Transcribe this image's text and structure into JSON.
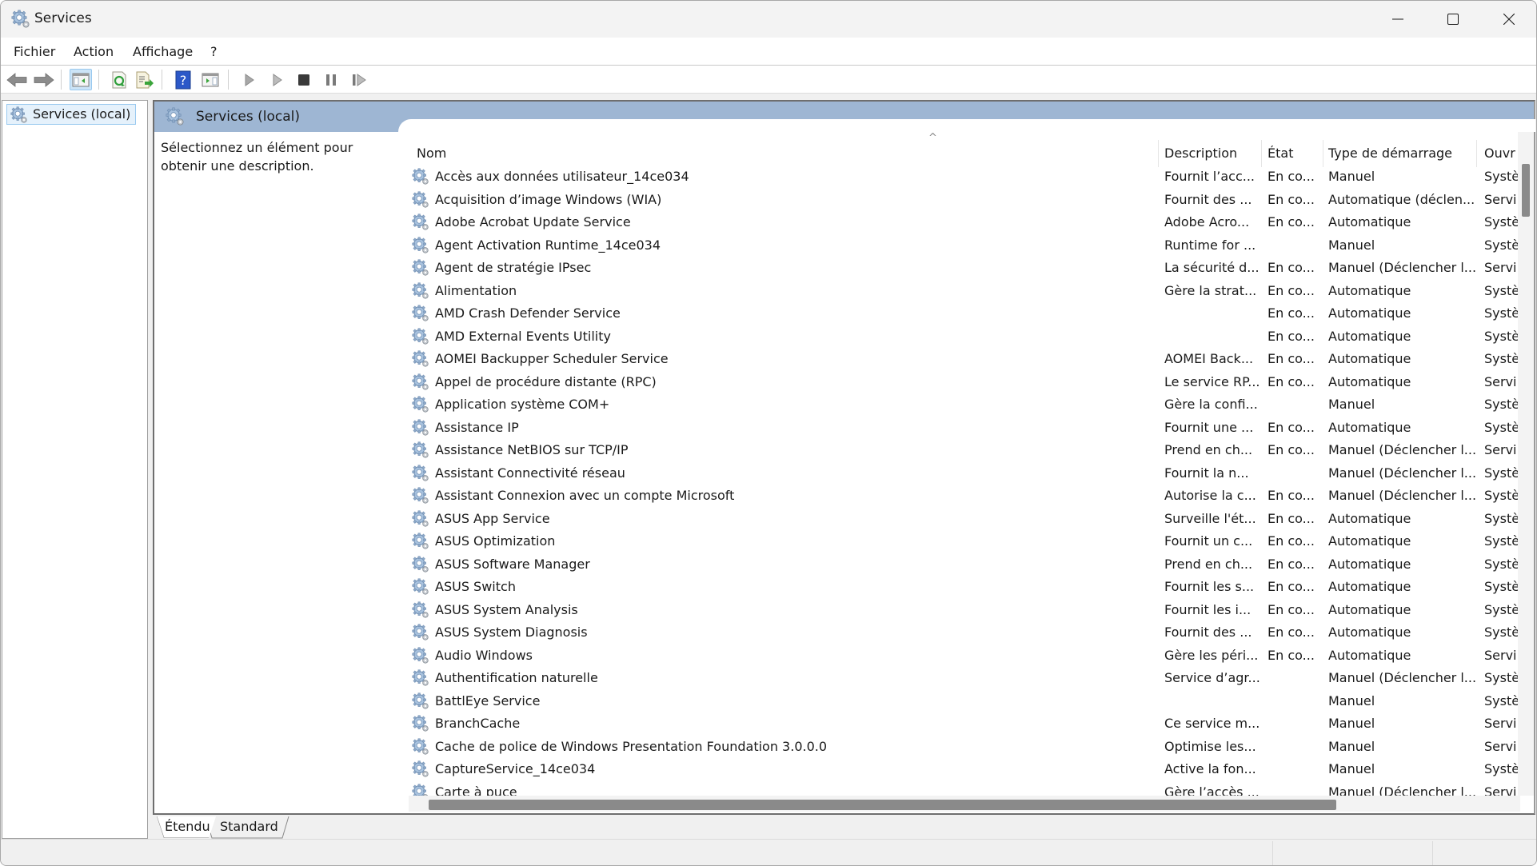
{
  "window": {
    "title": "Services",
    "app_icon": "services-gear-icon",
    "controls": {
      "minimize": "minimize-icon",
      "maximize": "maximize-icon",
      "close": "close-icon"
    }
  },
  "menu": {
    "items": [
      "Fichier",
      "Action",
      "Affichage",
      "?"
    ]
  },
  "toolbar": {
    "buttons": [
      {
        "name": "back",
        "icon": "arrow-left-icon"
      },
      {
        "name": "forward",
        "icon": "arrow-right-icon"
      },
      {
        "name": "show-hide-console-tree",
        "icon": "console-tree-icon",
        "active": true
      },
      {
        "name": "refresh",
        "icon": "refresh-icon"
      },
      {
        "name": "export-list",
        "icon": "export-list-icon"
      },
      {
        "name": "help",
        "icon": "help-icon"
      },
      {
        "name": "show-hide-action-pane",
        "icon": "action-pane-icon"
      },
      {
        "name": "start-service",
        "icon": "play-icon"
      },
      {
        "name": "start-service-alt",
        "icon": "play-outline-icon"
      },
      {
        "name": "stop-service",
        "icon": "stop-icon"
      },
      {
        "name": "pause-service",
        "icon": "pause-icon"
      },
      {
        "name": "restart-service",
        "icon": "restart-icon"
      }
    ]
  },
  "tree": {
    "selected_item": "Services (local)"
  },
  "main": {
    "header_title": "Services (local)",
    "description_prompt": "Sélectionnez un élément pour obtenir une description.",
    "columns": [
      "Nom",
      "Description",
      "État",
      "Type de démarrage",
      "Ouvr"
    ],
    "sorted_column": "Nom",
    "rows": [
      {
        "name": "Accès aux données utilisateur_14ce034",
        "description": "Fournit l’acc...",
        "state": "En co...",
        "startup": "Manuel",
        "logon": "Systè"
      },
      {
        "name": "Acquisition d’image Windows (WIA)",
        "description": "Fournit des ...",
        "state": "En co...",
        "startup": "Automatique (déclen...",
        "logon": "Servi"
      },
      {
        "name": "Adobe Acrobat Update Service",
        "description": "Adobe Acro...",
        "state": "En co...",
        "startup": "Automatique",
        "logon": "Systè"
      },
      {
        "name": "Agent Activation Runtime_14ce034",
        "description": "Runtime for ...",
        "state": "",
        "startup": "Manuel",
        "logon": "Systè"
      },
      {
        "name": "Agent de stratégie IPsec",
        "description": "La sécurité d...",
        "state": "En co...",
        "startup": "Manuel (Déclencher l...",
        "logon": "Servi"
      },
      {
        "name": "Alimentation",
        "description": "Gère la strat...",
        "state": "En co...",
        "startup": "Automatique",
        "logon": "Systè"
      },
      {
        "name": "AMD Crash Defender Service",
        "description": "",
        "state": "En co...",
        "startup": "Automatique",
        "logon": "Systè"
      },
      {
        "name": "AMD External Events Utility",
        "description": "",
        "state": "En co...",
        "startup": "Automatique",
        "logon": "Systè"
      },
      {
        "name": "AOMEI Backupper Scheduler Service",
        "description": "AOMEI Back...",
        "state": "En co...",
        "startup": "Automatique",
        "logon": "Systè"
      },
      {
        "name": "Appel de procédure distante (RPC)",
        "description": "Le service RP...",
        "state": "En co...",
        "startup": "Automatique",
        "logon": "Servi"
      },
      {
        "name": "Application système COM+",
        "description": "Gère la confi...",
        "state": "",
        "startup": "Manuel",
        "logon": "Systè"
      },
      {
        "name": "Assistance IP",
        "description": "Fournit une ...",
        "state": "En co...",
        "startup": "Automatique",
        "logon": "Systè"
      },
      {
        "name": "Assistance NetBIOS sur TCP/IP",
        "description": "Prend en ch...",
        "state": "En co...",
        "startup": "Manuel (Déclencher l...",
        "logon": "Servi"
      },
      {
        "name": "Assistant Connectivité réseau",
        "description": "Fournit la n...",
        "state": "",
        "startup": "Manuel (Déclencher l...",
        "logon": "Systè"
      },
      {
        "name": "Assistant Connexion avec un compte Microsoft",
        "description": "Autorise la c...",
        "state": "En co...",
        "startup": "Manuel (Déclencher l...",
        "logon": "Systè"
      },
      {
        "name": "ASUS App Service",
        "description": "Surveille l'ét...",
        "state": "En co...",
        "startup": "Automatique",
        "logon": "Systè"
      },
      {
        "name": "ASUS Optimization",
        "description": "Fournit un c...",
        "state": "En co...",
        "startup": "Automatique",
        "logon": "Systè"
      },
      {
        "name": "ASUS Software Manager",
        "description": "Prend en ch...",
        "state": "En co...",
        "startup": "Automatique",
        "logon": "Systè"
      },
      {
        "name": "ASUS Switch",
        "description": "Fournit les s...",
        "state": "En co...",
        "startup": "Automatique",
        "logon": "Systè"
      },
      {
        "name": "ASUS System Analysis",
        "description": "Fournit les i...",
        "state": "En co...",
        "startup": "Automatique",
        "logon": "Systè"
      },
      {
        "name": "ASUS System Diagnosis",
        "description": "Fournit des ...",
        "state": "En co...",
        "startup": "Automatique",
        "logon": "Systè"
      },
      {
        "name": "Audio Windows",
        "description": "Gère les péri...",
        "state": "En co...",
        "startup": "Automatique",
        "logon": "Servi"
      },
      {
        "name": "Authentification naturelle",
        "description": "Service d’agr...",
        "state": "",
        "startup": "Manuel (Déclencher l...",
        "logon": "Systè"
      },
      {
        "name": "BattlEye Service",
        "description": "",
        "state": "",
        "startup": "Manuel",
        "logon": "Systè"
      },
      {
        "name": "BranchCache",
        "description": "Ce service m...",
        "state": "",
        "startup": "Manuel",
        "logon": "Servi"
      },
      {
        "name": "Cache de police de Windows Presentation Foundation 3.0.0.0",
        "description": "Optimise les...",
        "state": "",
        "startup": "Manuel",
        "logon": "Servi"
      },
      {
        "name": "CaptureService_14ce034",
        "description": "Active la fon...",
        "state": "",
        "startup": "Manuel",
        "logon": "Systè"
      },
      {
        "name": "Carte à puce",
        "description": "Gère l’accès ...",
        "state": "",
        "startup": "Manuel (Déclencher l...",
        "logon": "Servi"
      }
    ]
  },
  "tabs": [
    {
      "label": "Étendu",
      "active": true
    },
    {
      "label": "Standard",
      "active": false
    }
  ],
  "colors": {
    "header_strip": "#9eb6d3",
    "selection_bg": "#e5f1fb",
    "selection_border": "#99c9ef",
    "scroll_thumb": "#8a8a8a"
  }
}
